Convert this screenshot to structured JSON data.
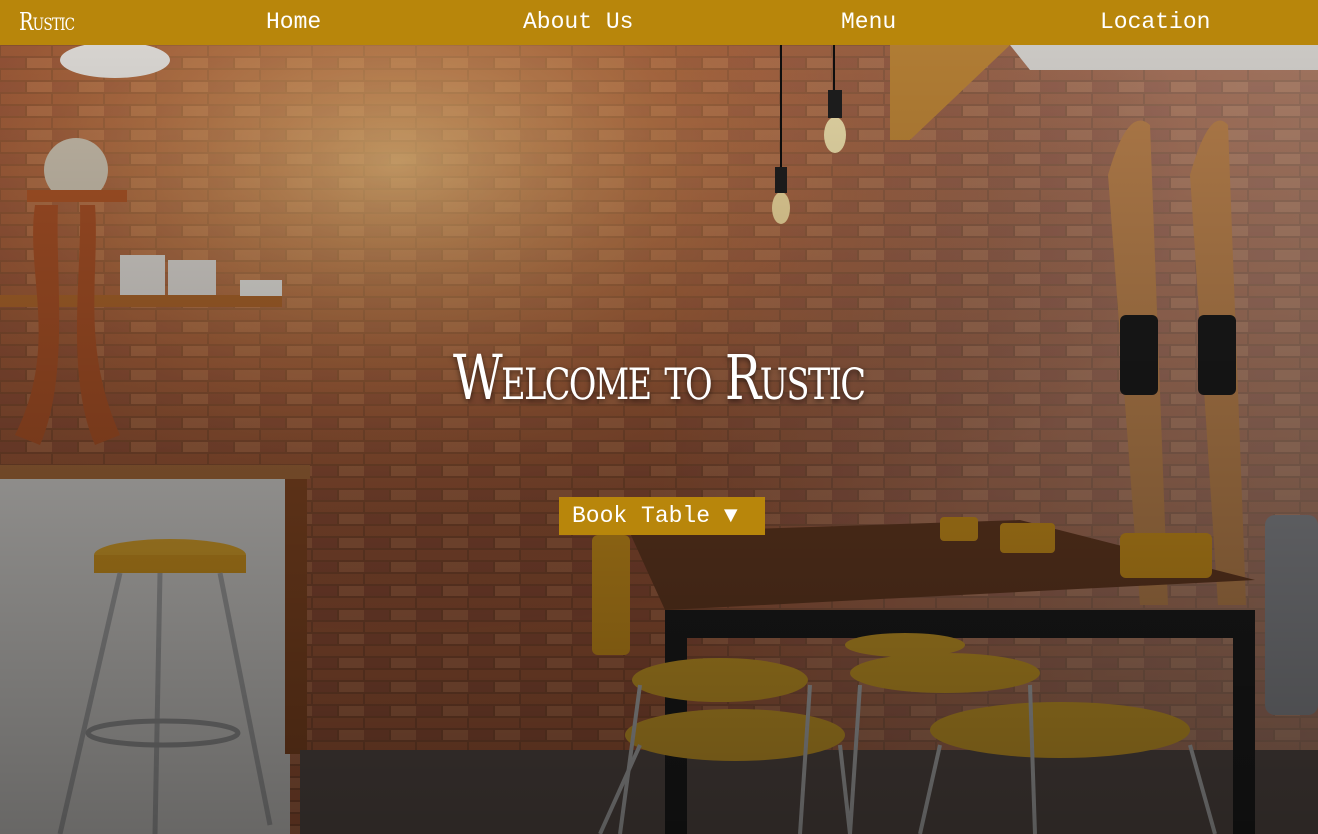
{
  "nav": {
    "brand": "Rustic",
    "links": [
      {
        "label": "Home"
      },
      {
        "label": "About Us"
      },
      {
        "label": "Menu"
      },
      {
        "label": "Location"
      }
    ]
  },
  "hero": {
    "title": "Welcome to Rustic",
    "book_button": "Book Table ▼"
  },
  "colors": {
    "accent": "#b8860b",
    "text": "#ffffff"
  }
}
